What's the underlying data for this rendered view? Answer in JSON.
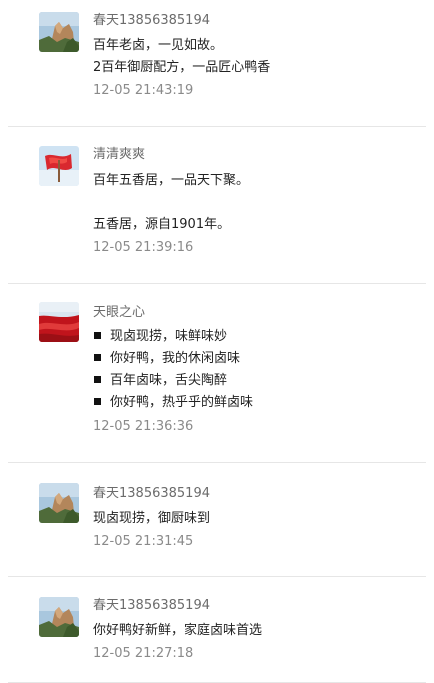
{
  "comments": [
    {
      "user": "春天13856385194",
      "avatar": "mountain-avatar",
      "lines": [
        "百年老卤，一见如故。",
        "2百年御厨配方，一品匠心鸭香"
      ],
      "time": "12-05 21:43:19"
    },
    {
      "user": "清清爽爽",
      "avatar": "red-flag-avatar",
      "lines": [
        "百年五香居，一品天下聚。",
        "五香居，源自1901年。"
      ],
      "time": "12-05 21:39:16"
    },
    {
      "user": "天眼之心",
      "avatar": "red-beach-avatar",
      "bullets": [
        "现卤现捞，味鲜味妙",
        "你好鸭，我的休闲卤味",
        "百年卤味，舌尖陶醉",
        "你好鸭，热乎乎的鲜卤味"
      ],
      "time": "12-05 21:36:36"
    },
    {
      "user": "春天13856385194",
      "avatar": "mountain-avatar",
      "lines": [
        "现卤现捞，御厨味到"
      ],
      "time": "12-05 21:31:45"
    },
    {
      "user": "春天13856385194",
      "avatar": "mountain-avatar",
      "lines": [
        "你好鸭好新鲜，家庭卤味首选"
      ],
      "time": "12-05 21:27:18"
    }
  ],
  "colors": {
    "divider": "#e6e6e6",
    "username": "#6b6b6b",
    "timestamp": "#8a8a8a",
    "text": "#222222"
  }
}
